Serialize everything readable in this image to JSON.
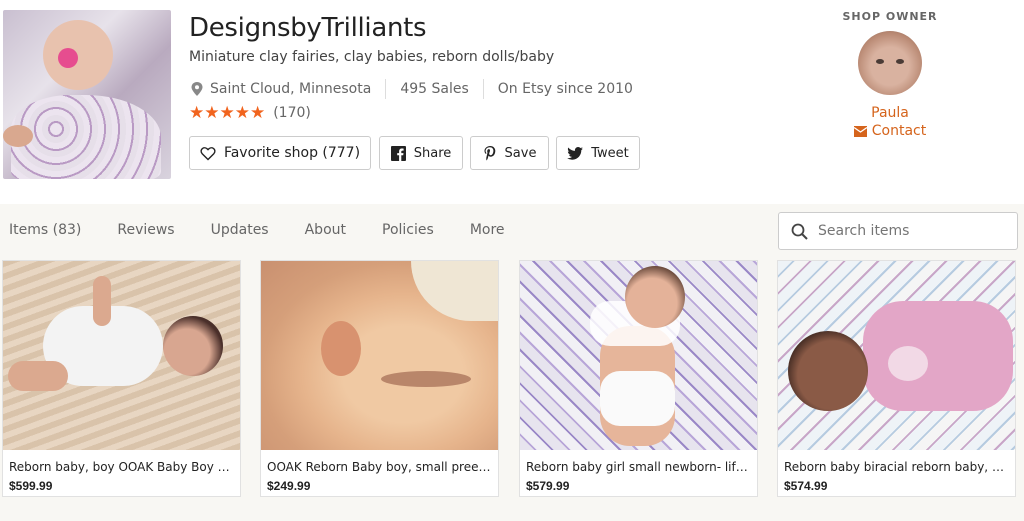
{
  "shop": {
    "name": "DesignsbyTrilliants",
    "tagline": "Miniature clay fairies, clay babies, reborn dolls/baby",
    "location": "Saint Cloud, Minnesota",
    "sales": "495 Sales",
    "since": "On Etsy since 2010",
    "stars": "★★★★★",
    "rating_count": "(170)",
    "rating_value": 5
  },
  "buttons": {
    "favorite": "Favorite shop (777)",
    "share": "Share",
    "save": "Save",
    "tweet": "Tweet"
  },
  "owner": {
    "label": "SHOP OWNER",
    "name": "Paula",
    "contact": "Contact"
  },
  "nav": {
    "tabs": [
      {
        "label": "Items (83)"
      },
      {
        "label": "Reviews"
      },
      {
        "label": "Updates"
      },
      {
        "label": "About"
      },
      {
        "label": "Policies"
      },
      {
        "label": "More"
      }
    ],
    "search_placeholder": "Search items"
  },
  "listings": [
    {
      "title": "Reborn baby, boy OOAK Baby Boy Reborn",
      "price": "$599.99"
    },
    {
      "title": "OOAK Reborn Baby boy, small preemie",
      "price": "$249.99"
    },
    {
      "title": "Reborn baby girl small newborn- life like",
      "price": "$579.99"
    },
    {
      "title": "Reborn baby biracial reborn baby, AA baby",
      "price": "$574.99"
    }
  ],
  "colors": {
    "accent": "#d5641c",
    "star": "#f1641e",
    "panel_bg": "#f8f7f3"
  }
}
